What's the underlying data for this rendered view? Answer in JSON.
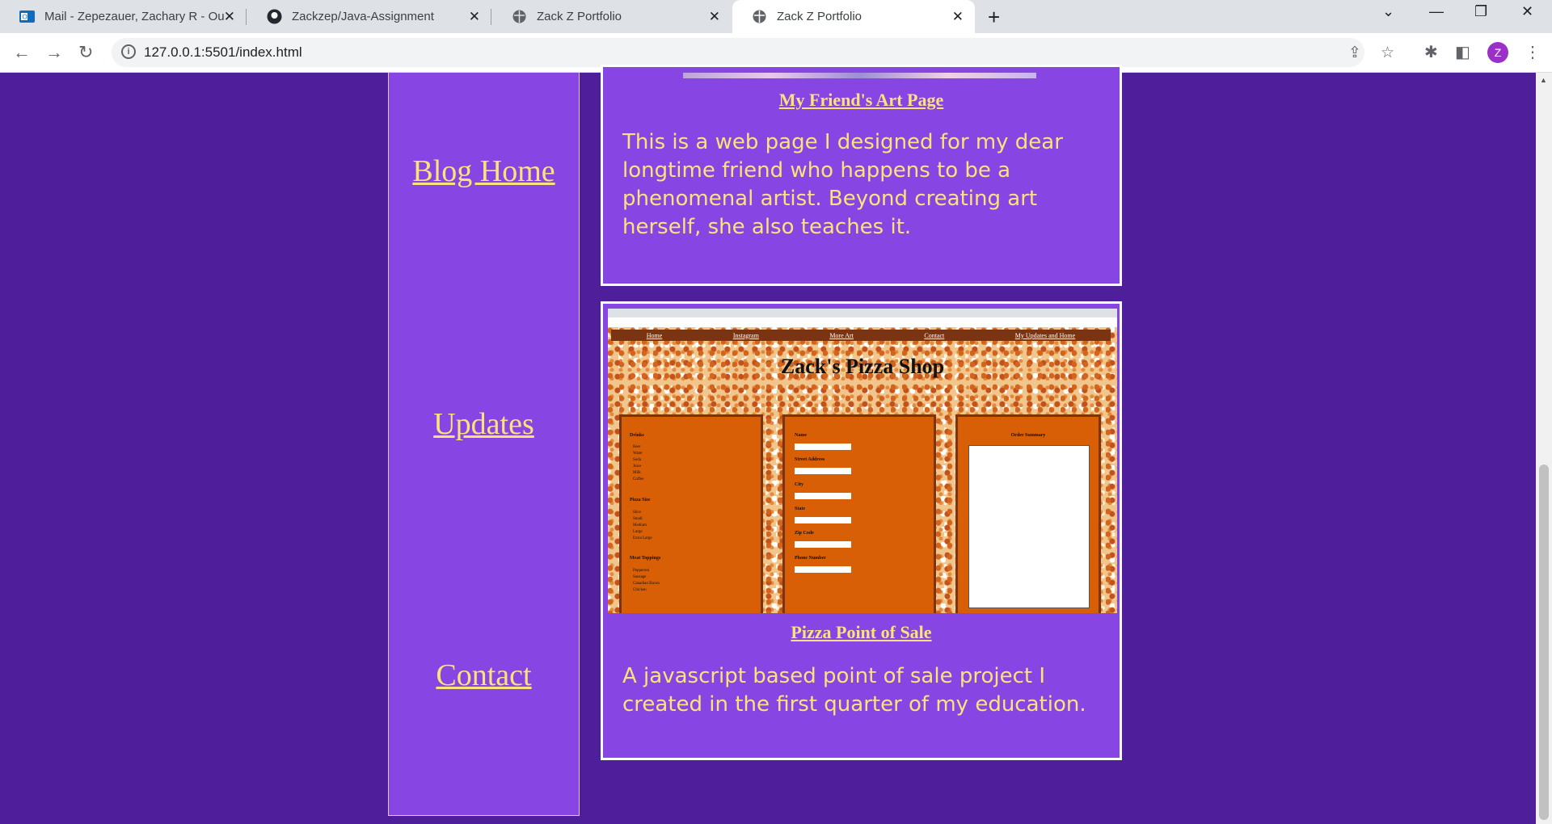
{
  "browser": {
    "tabs": [
      {
        "title": "Mail - Zepezauer, Zachary R - Ou",
        "icon": "outlook-icon"
      },
      {
        "title": "Zackzep/Java-Assignment",
        "icon": "github-icon"
      },
      {
        "title": "Zack Z Portfolio",
        "icon": "globe-icon"
      },
      {
        "title": "Zack Z Portfolio",
        "icon": "globe-icon",
        "active": true
      }
    ],
    "url": "127.0.0.1:5501/index.html",
    "profile_initial": "Z"
  },
  "sidebar": {
    "links": [
      "Blog Home",
      "Updates",
      "Contact"
    ]
  },
  "cards": [
    {
      "title": "My Friend's Art Page",
      "description": "This is a web page I designed for my dear longtime friend who happens to be a phenomenal artist. Beyond creating art herself, she also teaches it."
    },
    {
      "title": "Pizza Point of Sale",
      "description": "A javascript based point of sale project I created in the first quarter of my education.",
      "screenshot": {
        "nav": [
          "Home",
          "Instagram",
          "More Art",
          "Contact",
          "My Updates and Home"
        ],
        "heading": "Zack's Pizza Shop",
        "drinks_label": "Drinks",
        "drinks": [
          "Beer",
          "Water",
          "Soda",
          "Juice",
          "Milk",
          "Coffee"
        ],
        "size_label": "Pizza Size",
        "sizes": [
          "Slice",
          "Small",
          "Medium",
          "Large",
          "Extra Large"
        ],
        "meat_label": "Meat Toppings",
        "meats": [
          "Pepperoni",
          "Sausage",
          "Canadian Bacon",
          "Chicken"
        ],
        "fields": [
          "Name",
          "Street Address",
          "City",
          "State",
          "Zip Code",
          "Phone Number"
        ],
        "summary_label": "Order Summary"
      }
    }
  ],
  "colors": {
    "page_bg": "#4f1e9a",
    "panel_bg": "#8745e3",
    "link_text": "#fce27a"
  }
}
